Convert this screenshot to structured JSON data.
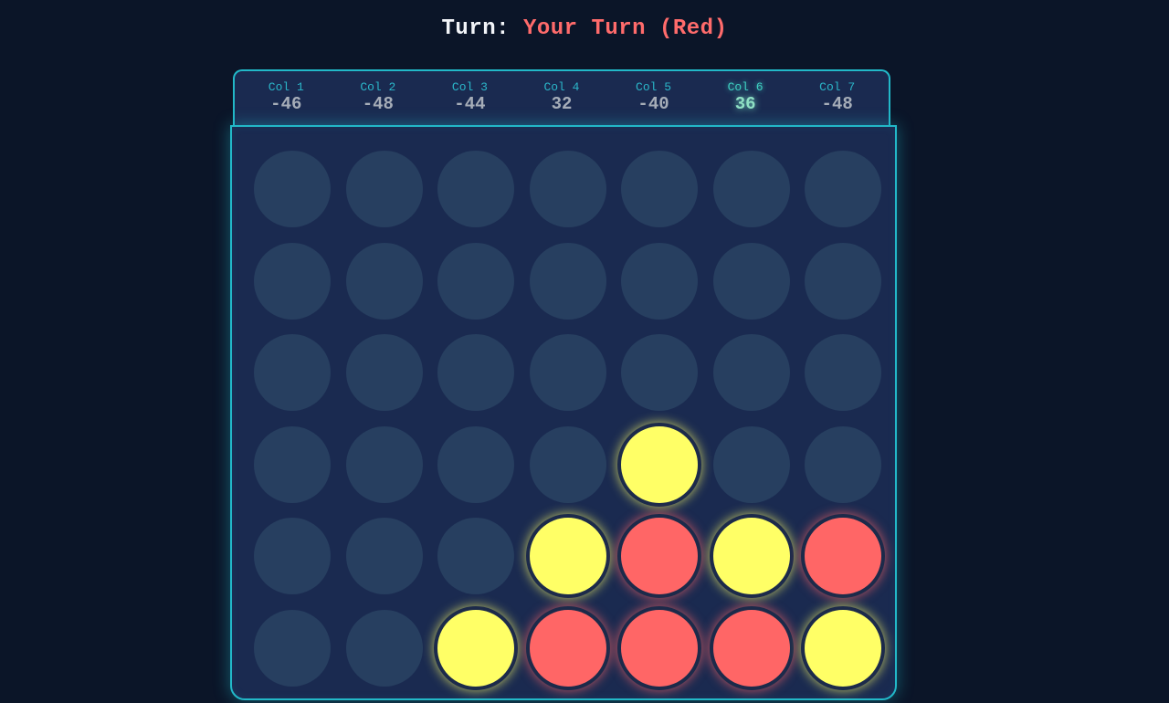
{
  "turn": {
    "label": "Turn:",
    "value": "Your Turn (Red)"
  },
  "scores": [
    {
      "label": "Col 1",
      "score": "-46",
      "best": false
    },
    {
      "label": "Col 2",
      "score": "-48",
      "best": false
    },
    {
      "label": "Col 3",
      "score": "-44",
      "best": false
    },
    {
      "label": "Col 4",
      "score": "32",
      "best": false
    },
    {
      "label": "Col 5",
      "score": "-40",
      "best": false
    },
    {
      "label": "Col 6",
      "score": "36",
      "best": true
    },
    {
      "label": "Col 7",
      "score": "-48",
      "best": false
    }
  ],
  "board": [
    [
      "empty",
      "empty",
      "empty",
      "empty",
      "empty",
      "empty",
      "empty"
    ],
    [
      "empty",
      "empty",
      "empty",
      "empty",
      "empty",
      "empty",
      "empty"
    ],
    [
      "empty",
      "empty",
      "empty",
      "empty",
      "empty",
      "empty",
      "empty"
    ],
    [
      "empty",
      "empty",
      "empty",
      "empty",
      "yellow",
      "empty",
      "empty"
    ],
    [
      "empty",
      "empty",
      "empty",
      "yellow",
      "red",
      "yellow",
      "red"
    ],
    [
      "empty",
      "empty",
      "yellow",
      "red",
      "red",
      "red",
      "yellow"
    ]
  ],
  "colors": {
    "background": "#0b1528",
    "board": "#1a2a50",
    "border": "#22b8c8",
    "empty_slot": "#273f60",
    "red": "#ff6666",
    "yellow": "#ffff66"
  }
}
